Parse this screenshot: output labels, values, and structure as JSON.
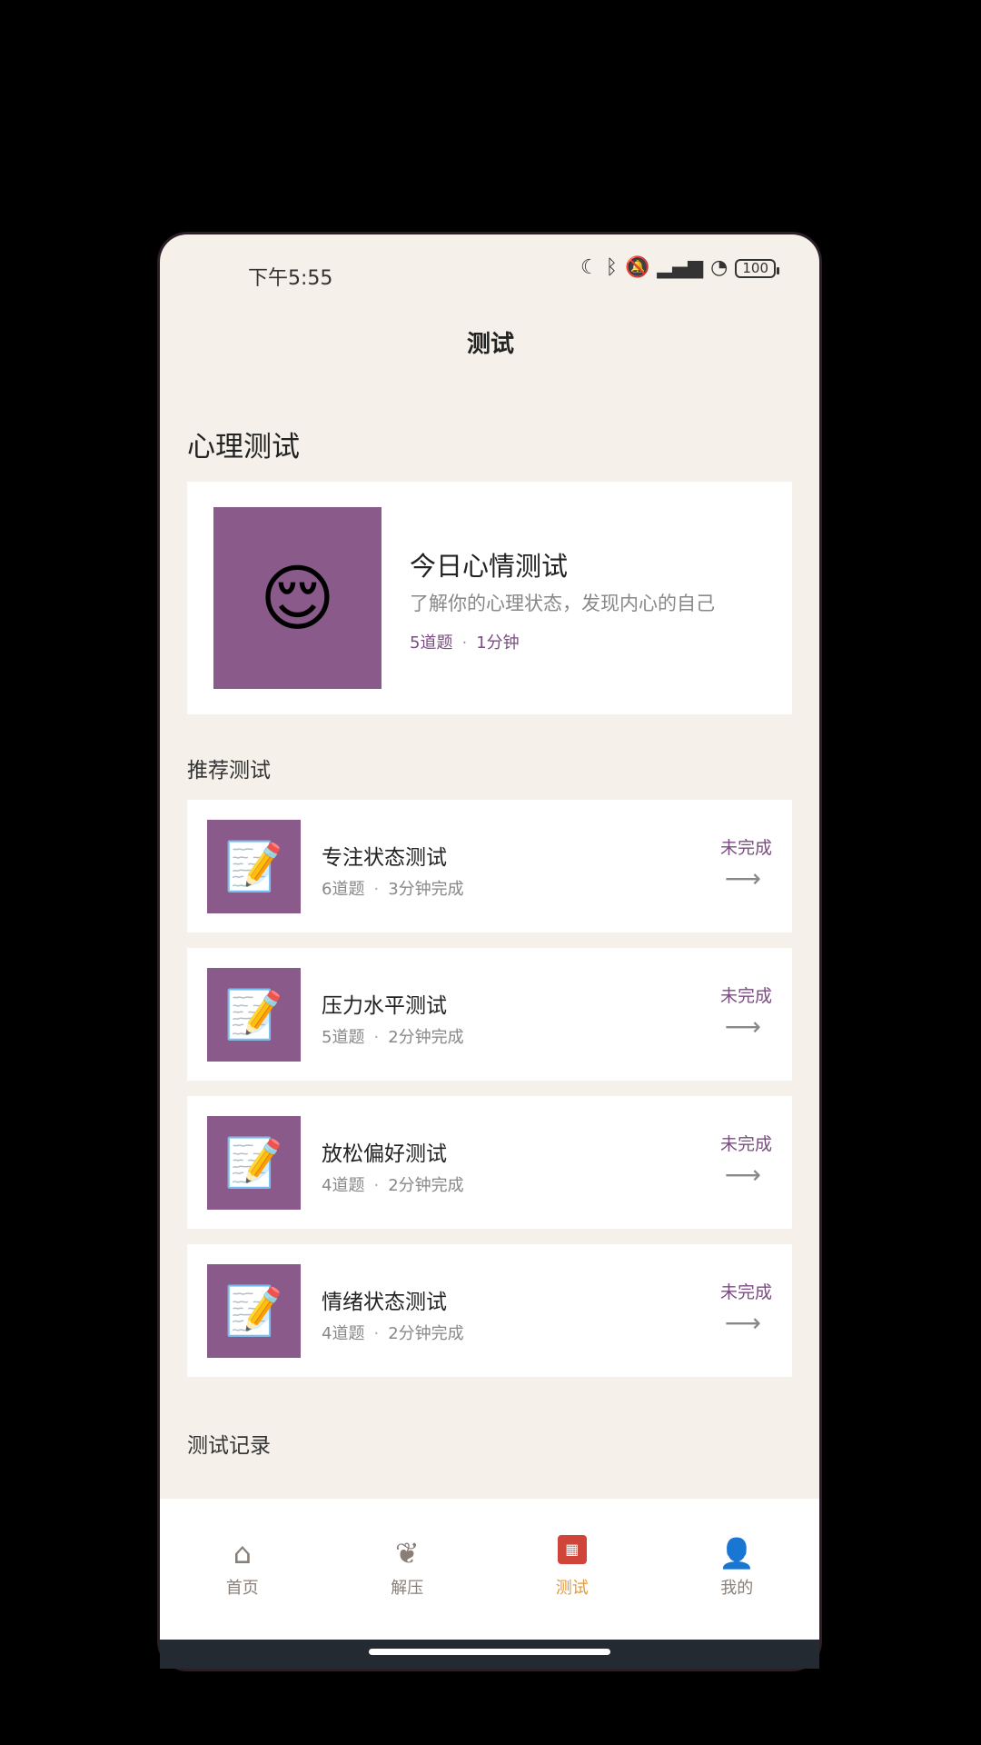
{
  "status": {
    "time": "下午5:55",
    "icons": [
      "moon-icon",
      "bluetooth-icon",
      "mute-icon",
      "hd-signal-icon",
      "wifi-icon",
      "battery-icon"
    ],
    "battery": "100"
  },
  "header": {
    "title": "测试"
  },
  "main_section": {
    "title": "心理测试",
    "hero": {
      "emoji": "😌",
      "title": "今日心情测试",
      "desc": "了解你的心理状态，发现内心的自己",
      "questions": "5道题",
      "duration": "1分钟",
      "separator": "·"
    }
  },
  "recommend": {
    "title": "推荐测试",
    "items": [
      {
        "emoji": "📝",
        "title": "专注状态测试",
        "questions": "6道题",
        "duration": "3分钟完成",
        "separator": "·",
        "status": "未完成",
        "arrow": "⟶"
      },
      {
        "emoji": "📝",
        "title": "压力水平测试",
        "questions": "5道题",
        "duration": "2分钟完成",
        "separator": "·",
        "status": "未完成",
        "arrow": "⟶"
      },
      {
        "emoji": "📝",
        "title": "放松偏好测试",
        "questions": "4道题",
        "duration": "2分钟完成",
        "separator": "·",
        "status": "未完成",
        "arrow": "⟶"
      },
      {
        "emoji": "📝",
        "title": "情绪状态测试",
        "questions": "4道题",
        "duration": "2分钟完成",
        "separator": "·",
        "status": "未完成",
        "arrow": "⟶"
      }
    ]
  },
  "records": {
    "title": "测试记录"
  },
  "tabbar": {
    "tabs": [
      {
        "label": "首页",
        "icon": "⌂"
      },
      {
        "label": "解压",
        "icon": "❦"
      },
      {
        "label": "测试",
        "icon": "▦"
      },
      {
        "label": "我的",
        "icon": "👤"
      }
    ]
  },
  "colors": {
    "accent": "#8a5a8a",
    "active_tab": "#e09a3a",
    "active_icon_bg": "#d0453a",
    "background": "#f5f0ea"
  }
}
